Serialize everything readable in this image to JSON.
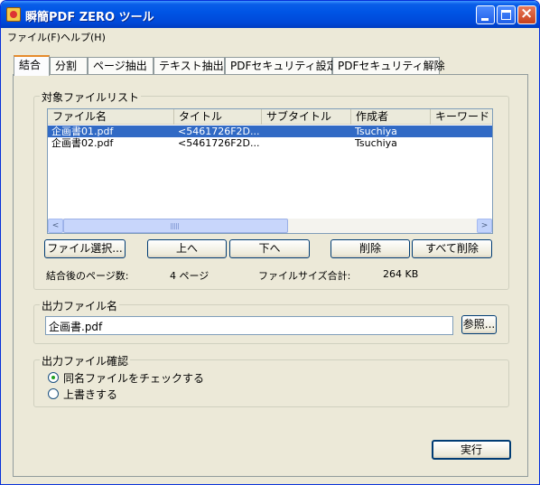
{
  "window": {
    "title": "瞬簡PDF ZERO ツール"
  },
  "menu": {
    "file": "ファイル(F)",
    "help": "ヘルプ(H)"
  },
  "tabs": [
    {
      "label": "結合",
      "active": true
    },
    {
      "label": "分割"
    },
    {
      "label": "ページ抽出"
    },
    {
      "label": "テキスト抽出"
    },
    {
      "label": "PDFセキュリティ設定"
    },
    {
      "label": "PDFセキュリティ解除"
    }
  ],
  "file_list": {
    "group_label": "対象ファイルリスト",
    "columns": [
      "ファイル名",
      "タイトル",
      "サブタイトル",
      "作成者",
      "キーワード"
    ],
    "rows": [
      {
        "filename": "企画書01.pdf",
        "title": "<5461726F2D...",
        "subtitle": "",
        "author": "Tsuchiya",
        "keywords": "",
        "selected": true
      },
      {
        "filename": "企画書02.pdf",
        "title": "<5461726F2D...",
        "subtitle": "",
        "author": "Tsuchiya",
        "keywords": "",
        "selected": false
      }
    ],
    "scroll_left_arrow": "<",
    "scroll_right_arrow": ">",
    "buttons": {
      "select_file": "ファイル選択...",
      "up": "上へ",
      "down": "下へ",
      "delete": "削除",
      "delete_all": "すべて削除"
    },
    "page_count_label": "結合後のページ数:",
    "page_count_value": "4 ページ",
    "file_size_label": "ファイルサイズ合計:",
    "file_size_value": "264 KB"
  },
  "output_file": {
    "group_label": "出力ファイル名",
    "value": "企画書.pdf",
    "browse_button": "参照..."
  },
  "output_confirm": {
    "group_label": "出力ファイル確認",
    "options": [
      {
        "label": "同名ファイルをチェックする",
        "checked": true
      },
      {
        "label": "上書きする",
        "checked": false
      }
    ]
  },
  "execute_button": "実行"
}
